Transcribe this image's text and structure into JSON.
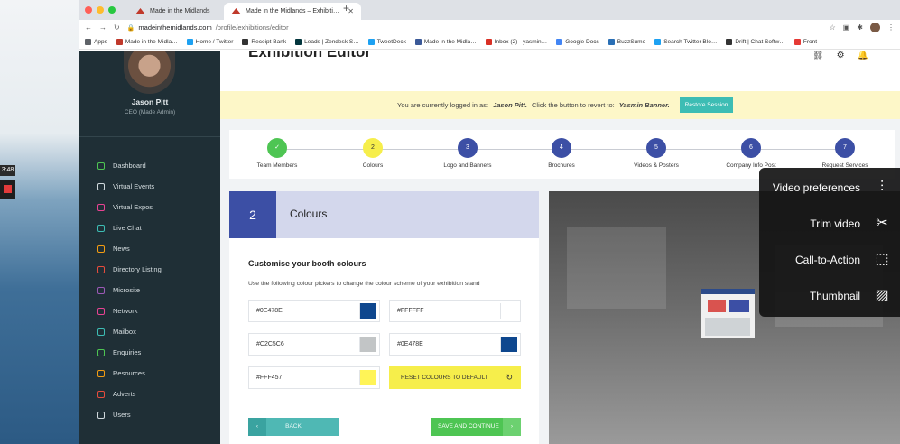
{
  "recorder": {
    "time": "3:48"
  },
  "browser": {
    "tabs": [
      {
        "label": "Made in the Midlands"
      },
      {
        "label": "Made in the Midlands – Exhibiti…"
      }
    ],
    "url_domain": "madeinthemidlands.com",
    "url_path": "/profile/exhibitions/editor",
    "bookmarks": [
      {
        "label": "Apps",
        "color": "#5f6368"
      },
      {
        "label": "Made in the Midla…",
        "color": "#c0392b"
      },
      {
        "label": "Home / Twitter",
        "color": "#1da1f2"
      },
      {
        "label": "Receipt Bank",
        "color": "#333333"
      },
      {
        "label": "Leads | Zendesk S…",
        "color": "#03363d"
      },
      {
        "label": "TweetDeck",
        "color": "#1da1f2"
      },
      {
        "label": "Made in the Midla…",
        "color": "#3b5998"
      },
      {
        "label": "Inbox (2) - yasmin…",
        "color": "#d93025"
      },
      {
        "label": "Google Docs",
        "color": "#4285f4"
      },
      {
        "label": "BuzzSumo",
        "color": "#2a6fb5"
      },
      {
        "label": "Search Twitter Blo…",
        "color": "#1da1f2"
      },
      {
        "label": "Drift | Chat Softw…",
        "color": "#333333"
      },
      {
        "label": "Front",
        "color": "#e53935"
      }
    ]
  },
  "sidebar": {
    "user_name": "Jason Pitt",
    "user_role": "CEO (Made Admin)",
    "items": [
      {
        "label": "Dashboard",
        "color": "#4ec553"
      },
      {
        "label": "Virtual Events",
        "color": "#cfd8dc"
      },
      {
        "label": "Virtual Expos",
        "color": "#e84393"
      },
      {
        "label": "Live Chat",
        "color": "#3dbdb4"
      },
      {
        "label": "News",
        "color": "#f39c12"
      },
      {
        "label": "Directory Listing",
        "color": "#e74c3c"
      },
      {
        "label": "Microsite",
        "color": "#9b59b6"
      },
      {
        "label": "Network",
        "color": "#e84393"
      },
      {
        "label": "Mailbox",
        "color": "#3dbdb4"
      },
      {
        "label": "Enquiries",
        "color": "#4ec553"
      },
      {
        "label": "Resources",
        "color": "#f39c12"
      },
      {
        "label": "Adverts",
        "color": "#e74c3c"
      },
      {
        "label": "Users",
        "color": "#cfd8dc"
      }
    ]
  },
  "main": {
    "title": "Exhibition Editor",
    "banner": {
      "prefix": "You are currently logged in as:",
      "user": "Jason Pitt.",
      "middle": "Click the button to revert to:",
      "revert_user": "Yasmin Banner.",
      "button": "Restore Session"
    },
    "steps": [
      {
        "num": "✓",
        "label": "Team Members",
        "color": "#4ec553"
      },
      {
        "num": "2",
        "label": "Colours",
        "color": "#f6ee4b"
      },
      {
        "num": "3",
        "label": "Logo and Banners",
        "color": "#3c4fa5"
      },
      {
        "num": "4",
        "label": "Brochures",
        "color": "#3c4fa5"
      },
      {
        "num": "5",
        "label": "Videos & Posters",
        "color": "#3c4fa5"
      },
      {
        "num": "6",
        "label": "Company Info Post",
        "color": "#3c4fa5"
      },
      {
        "num": "7",
        "label": "Request Services",
        "color": "#3c4fa5"
      }
    ],
    "panel": {
      "number": "2",
      "title": "Colours",
      "subtitle": "Customise your booth colours",
      "description": "Use the following colour pickers to change the colour scheme of your exhibition stand",
      "fields": [
        {
          "value": "#0E478E",
          "swatch": "#0E478E"
        },
        {
          "value": "#FFFFFF",
          "swatch": "#FFFFFF"
        },
        {
          "value": "#C2C5C6",
          "swatch": "#C2C5C6"
        },
        {
          "value": "#0E478E",
          "swatch": "#0E478E"
        },
        {
          "value": "#FFF457",
          "swatch": "#FFF457"
        }
      ],
      "reset_label": "RESET COLOURS TO DEFAULT",
      "back_label": "BACK",
      "save_label": "SAVE AND CONTINUE"
    }
  },
  "video_menu": {
    "items": [
      {
        "label": "Video preferences",
        "icon": "sliders-icon"
      },
      {
        "label": "Trim video",
        "icon": "scissors-icon"
      },
      {
        "label": "Call-to-Action",
        "icon": "cursor-icon"
      },
      {
        "label": "Thumbnail",
        "icon": "image-icon"
      }
    ]
  }
}
